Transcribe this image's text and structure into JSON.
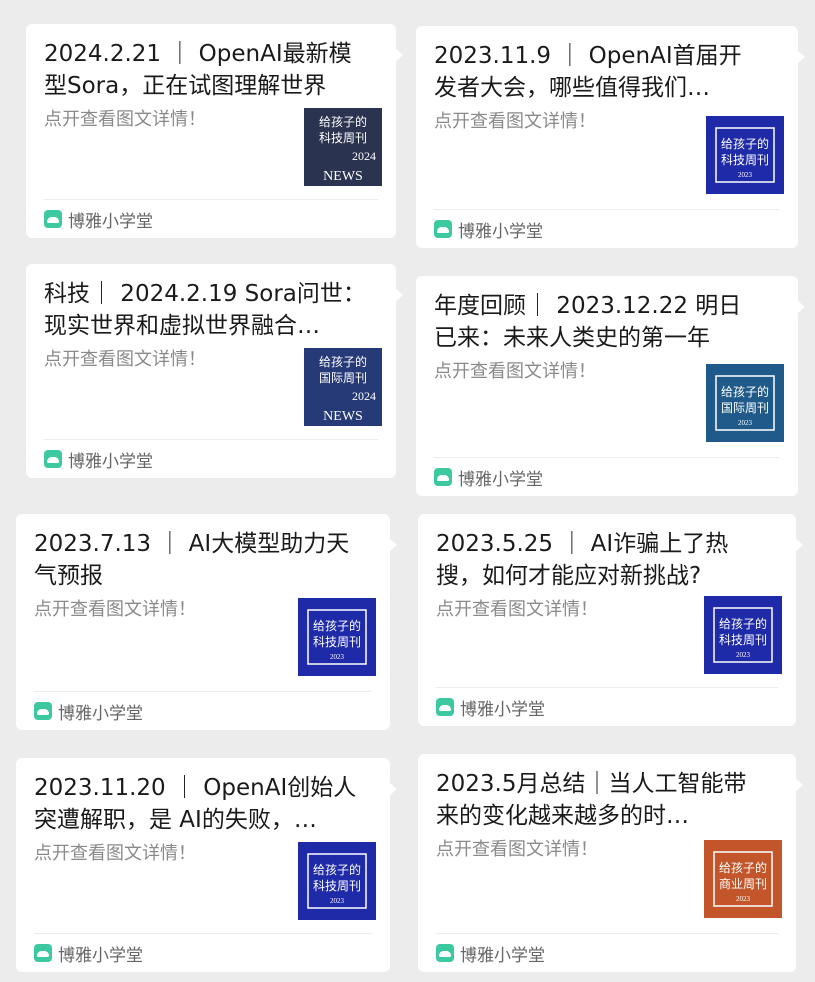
{
  "cards": [
    {
      "title": "2024.2.21 ｜ OpenAI最新模型Sora，正在试图理解世界",
      "desc": "点开查看图文详情！",
      "account": "博雅小学堂",
      "thumb": {
        "line1": "给孩子的",
        "line2": "科技周刊",
        "year": "2024",
        "extra": "NEWS",
        "bg": "#2a3350",
        "accent": "#ffffff"
      }
    },
    {
      "title": "2023.11.9 ｜ OpenAI首届开发者大会，哪些值得我们…",
      "desc": "点开查看图文详情！",
      "account": "博雅小学堂",
      "thumb": {
        "line1": "给孩子的",
        "line2": "科技周刊",
        "year": "2023",
        "extra": "",
        "bg": "#1e2aa8",
        "accent": "#ffffff"
      }
    },
    {
      "title": "科技｜ 2024.2.19 Sora问世：现实世界和虚拟世界融合…",
      "desc": "点开查看图文详情！",
      "account": "博雅小学堂",
      "thumb": {
        "line1": "给孩子的",
        "line2": "国际周刊",
        "year": "2024",
        "extra": "NEWS",
        "bg": "#263a78",
        "accent": "#ffffff"
      }
    },
    {
      "title": "年度回顾｜ 2023.12.22 明日已来：未来人类史的第一年",
      "desc": "点开查看图文详情！",
      "account": "博雅小学堂",
      "thumb": {
        "line1": "给孩子的",
        "line2": "国际周刊",
        "year": "2023",
        "extra": "",
        "bg": "#1f5a8a",
        "accent": "#ffffff"
      }
    },
    {
      "title": "2023.7.13 ｜ AI大模型助力天气预报",
      "desc": "点开查看图文详情！",
      "account": "博雅小学堂",
      "thumb": {
        "line1": "给孩子的",
        "line2": "科技周刊",
        "year": "2023",
        "extra": "",
        "bg": "#1e2aa8",
        "accent": "#ffffff"
      }
    },
    {
      "title": "2023.5.25 ｜ AI诈骗上了热搜，如何才能应对新挑战?",
      "desc": "点开查看图文详情！",
      "account": "博雅小学堂",
      "thumb": {
        "line1": "给孩子的",
        "line2": "科技周刊",
        "year": "2023",
        "extra": "",
        "bg": "#1e2aa8",
        "accent": "#ffffff"
      }
    },
    {
      "title": "2023.11.20 ｜ OpenAI创始人突遭解职，是 AI的失败，…",
      "desc": "点开查看图文详情！",
      "account": "博雅小学堂",
      "thumb": {
        "line1": "给孩子的",
        "line2": "科技周刊",
        "year": "2023",
        "extra": "",
        "bg": "#1e2aa8",
        "accent": "#ffffff"
      }
    },
    {
      "title": "2023.5月总结｜当人工智能带来的变化越来越多的时…",
      "desc": "点开查看图文详情！",
      "account": "博雅小学堂",
      "thumb": {
        "line1": "给孩子的",
        "line2": "商业周刊",
        "year": "2023",
        "extra": "",
        "bg": "#c2562a",
        "accent": "#ffffff"
      }
    }
  ]
}
